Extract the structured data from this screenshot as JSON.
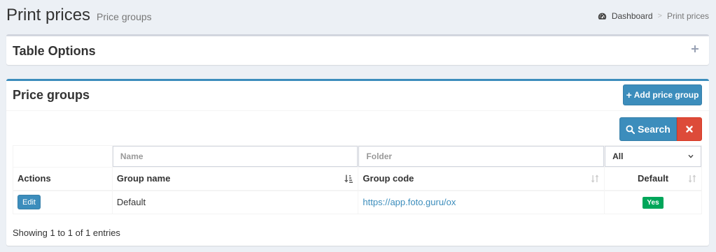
{
  "header": {
    "title": "Print prices",
    "subtitle": "Price groups"
  },
  "breadcrumb": {
    "home_icon": "dashboard-icon",
    "home": "Dashboard",
    "separator": ">",
    "current": "Print prices"
  },
  "table_options": {
    "title": "Table Options",
    "toggle_icon": "plus-icon"
  },
  "price_groups": {
    "title": "Price groups",
    "add_button": "Add price group",
    "search_button": "Search",
    "clear_icon": "times-icon",
    "filters": {
      "name_placeholder": "Name",
      "folder_placeholder": "Folder",
      "default_select": "All"
    },
    "columns": [
      "Actions",
      "Group name",
      "Group code",
      "Default"
    ],
    "rows": [
      {
        "action": "Edit",
        "group_name": "Default",
        "group_code": "https://app.foto.guru/ox",
        "default": "Yes"
      }
    ],
    "footer": "Showing 1 to 1 of 1 entries"
  },
  "colors": {
    "primary": "#3c8dbc",
    "danger": "#dd4b39",
    "success": "#00a65a",
    "background": "#ecf0f5"
  }
}
